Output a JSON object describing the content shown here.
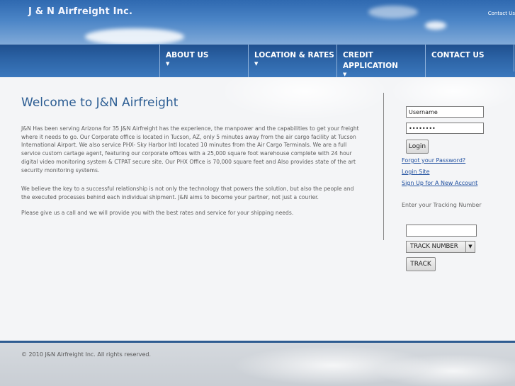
{
  "header": {
    "logo": "J & N Airfreight Inc.",
    "contact_link": "Contact Us"
  },
  "nav": {
    "items": [
      {
        "label": "ABOUT US"
      },
      {
        "label": "LOCATION & RATES"
      },
      {
        "label": "CREDIT APPLICATION"
      },
      {
        "label": "CONTACT US"
      }
    ]
  },
  "main": {
    "title": "Welcome to J&N Airfreight",
    "paragraphs": [
      "J&N Has been serving Arizona for 35 J&N Airfreight has the experience, the manpower and the capabilities to get your freight where it needs to go. Our Corporate office is located in Tucson, AZ, only 5 minutes away from the air cargo facility at Tucson International Airport. We also service PHX- Sky Harbor Intl located 10 minutes from the Air Cargo Terminals. We are a full service custom cartage agent, featuring our corporate offices with a 25,000 square foot warehouse complete with 24 hour digital video monitoring system & CTPAT secure site.  Our PHX Office is 70,000 square feet and Also provides state of the art security monitoring systems.",
      "We believe the key to a successful relationship is not only the technology that powers the solution, but also the people and the executed processes behind each individual shipment. J&N aims to become your partner, not just a courier.",
      "Please give us a call and we will provide you with the best rates and service for your shipping needs."
    ]
  },
  "sidebar": {
    "username_value": "Username",
    "password_value": "••••••••",
    "login_label": "Login",
    "forgot_link": "Forgot your Password?",
    "login_site_link": "Login Site",
    "signup_link": "Sign Up for A New Account",
    "tracking_label": "Enter your Tracking Number",
    "tracking_value": "",
    "select_value": "TRACK NUMBER",
    "track_button": "TRACK"
  },
  "footer": {
    "copyright": "© 2010 J&N Airfreight Inc. All rights reserved."
  },
  "colors": {
    "header_blue": "#2f69b0",
    "nav_blue": "#2b62a4",
    "title_blue": "#2c5d93",
    "link_blue": "#2050a0"
  }
}
